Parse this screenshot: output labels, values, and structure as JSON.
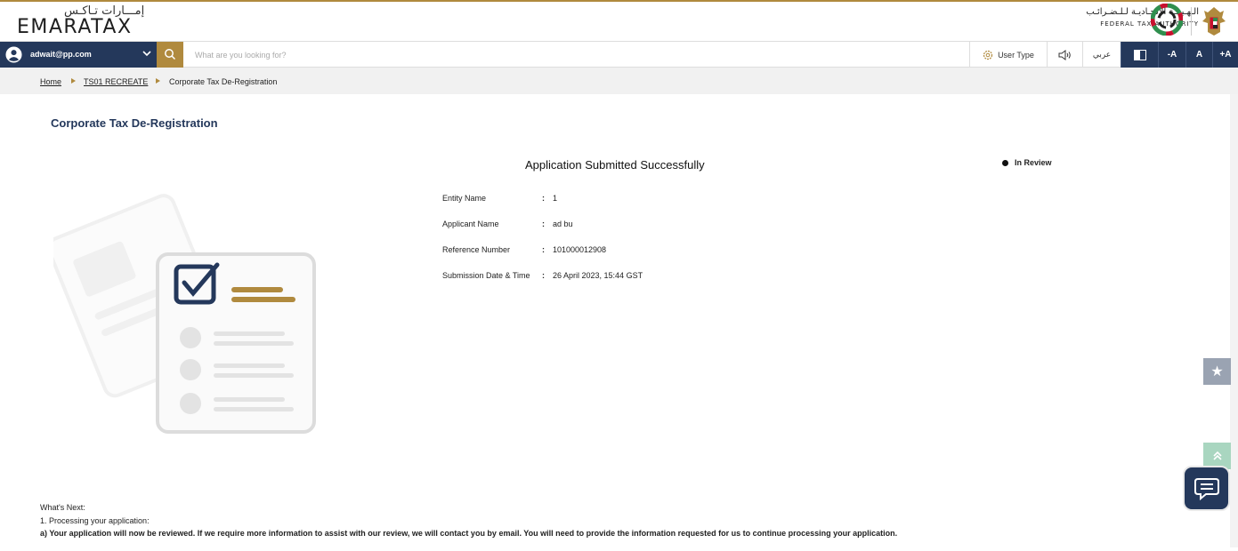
{
  "header": {
    "logo_arabic": "إمـــارات تـاكـس",
    "logo_english": "EMARATAX",
    "authority_arabic": "الـهـيـئـة الاتحـاديـة لـلـضـرائـب",
    "authority_english": "FEDERAL TAX AUTHORITY"
  },
  "toolbar": {
    "user_email": "adwait@pp.com",
    "search_placeholder": "What are you looking for?",
    "user_type_label": "User Type",
    "arabic_label": "عربي",
    "font_decrease": "-A",
    "font_normal": "A",
    "font_increase": "+A"
  },
  "breadcrumb": {
    "home": "Home",
    "parent": "TS01 RECREATE",
    "current": "Corporate Tax De-Registration"
  },
  "main": {
    "page_title": "Corporate Tax De-Registration",
    "success_title": "Application Submitted Successfully",
    "status": "In Review",
    "details": [
      {
        "label": "Entity Name",
        "value": "1"
      },
      {
        "label": "Applicant Name",
        "value": "ad bu"
      },
      {
        "label": "Reference Number",
        "value": "101000012908"
      },
      {
        "label": "Submission Date & Time",
        "value": "26 April 2023, 15:44 GST"
      }
    ],
    "colon": ":"
  },
  "whats_next": {
    "heading": "What's Next:",
    "step1": "1. Processing your application:",
    "line_a": "a) Your application will now be reviewed. If we require more information to assist with our review, we will contact you by email. You will need to provide the information requested for us to continue processing your application."
  },
  "icons": {
    "fav": "star-icon",
    "top": "double-chevron-up-icon",
    "chat": "chat-icon"
  },
  "colors": {
    "navy": "#24385b",
    "gold": "#b08a3e"
  }
}
